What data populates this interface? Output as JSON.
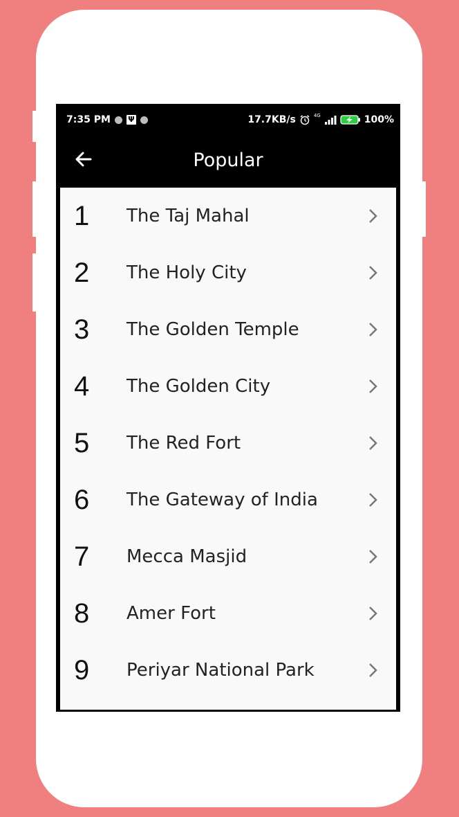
{
  "status_bar": {
    "time": "7:35 PM",
    "speed": "17.7KB/s",
    "network": "4G",
    "battery": "100%"
  },
  "app_bar": {
    "title": "Popular",
    "back_icon": "arrow-left-icon"
  },
  "items": [
    {
      "number": "1",
      "name": "The Taj Mahal"
    },
    {
      "number": "2",
      "name": "The Holy City"
    },
    {
      "number": "3",
      "name": "The Golden Temple"
    },
    {
      "number": "4",
      "name": "The Golden City"
    },
    {
      "number": "5",
      "name": "The Red Fort"
    },
    {
      "number": "6",
      "name": "The Gateway of India"
    },
    {
      "number": "7",
      "name": "Mecca Masjid"
    },
    {
      "number": "8",
      "name": "Amer Fort"
    },
    {
      "number": "9",
      "name": "Periyar National Park"
    }
  ],
  "colors": {
    "background": "#f08080",
    "app_bar": "#000000",
    "list_background": "#f9f9f9"
  }
}
